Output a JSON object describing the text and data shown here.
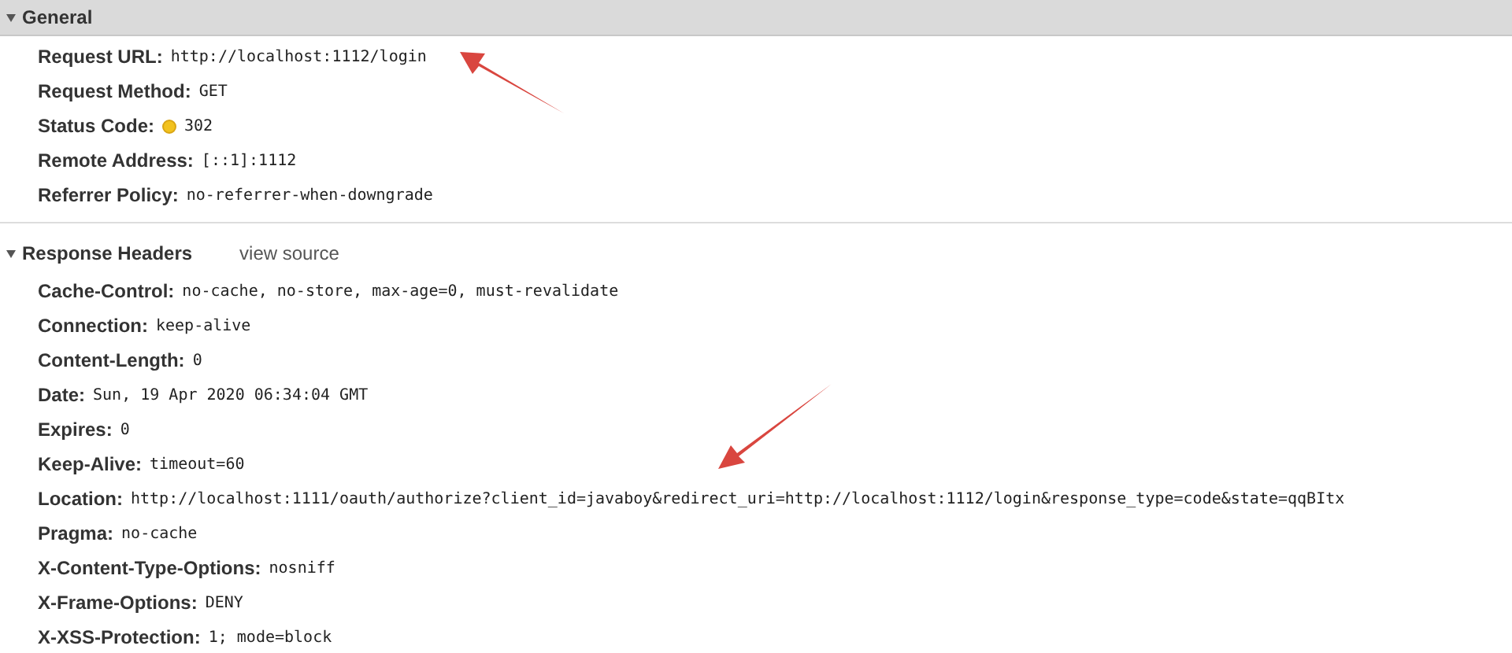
{
  "sections": [
    {
      "title": "General",
      "expanded": true,
      "rows": [
        {
          "name": "Request URL:",
          "value": "http://localhost:1112/login"
        },
        {
          "name": "Request Method:",
          "value": "GET"
        },
        {
          "name": "Status Code:",
          "value": "302",
          "kind": "status"
        },
        {
          "name": "Remote Address:",
          "value": "[::1]:1112"
        },
        {
          "name": "Referrer Policy:",
          "value": "no-referrer-when-downgrade"
        }
      ]
    },
    {
      "title": "Response Headers",
      "expanded": true,
      "link": "view source",
      "rows": [
        {
          "name": "Cache-Control:",
          "value": "no-cache, no-store, max-age=0, must-revalidate"
        },
        {
          "name": "Connection:",
          "value": "keep-alive"
        },
        {
          "name": "Content-Length:",
          "value": "0"
        },
        {
          "name": "Date:",
          "value": "Sun, 19 Apr 2020 06:34:04 GMT"
        },
        {
          "name": "Expires:",
          "value": "0"
        },
        {
          "name": "Keep-Alive:",
          "value": "timeout=60"
        },
        {
          "name": "Location:",
          "value": "http://localhost:1111/oauth/authorize?client_id=javaboy&redirect_uri=http://localhost:1112/login&response_type=code&state=qqBItx"
        },
        {
          "name": "Pragma:",
          "value": "no-cache"
        },
        {
          "name": "X-Content-Type-Options:",
          "value": "nosniff"
        },
        {
          "name": "X-Frame-Options:",
          "value": "DENY"
        },
        {
          "name": "X-XSS-Protection:",
          "value": "1; mode=block"
        }
      ]
    }
  ]
}
